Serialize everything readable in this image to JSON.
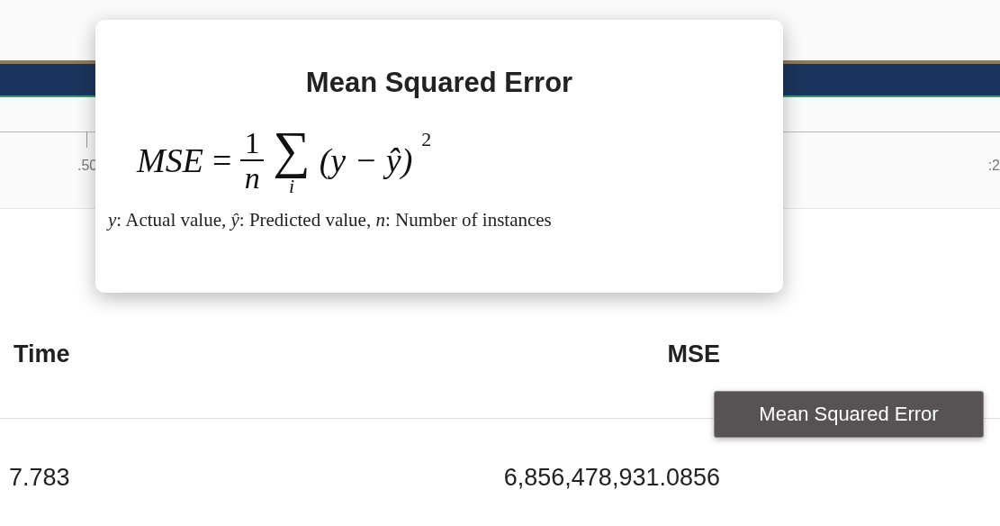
{
  "timeline": {
    "axis_labels": [
      ".50",
      ":2"
    ]
  },
  "popover": {
    "title": "Mean Squared Error",
    "formula": {
      "lhs": "MSE",
      "equals": "=",
      "numerator": "1",
      "denominator": "n",
      "sum": "∑",
      "sum_index": "i",
      "body": "(y − ŷ)",
      "exponent": "2"
    },
    "legend": "*y*: Actual value, *ŷ*: Predicted value, *n*: Number of instances"
  },
  "table": {
    "columns": [
      "Time",
      "MSE"
    ],
    "rows": [
      [
        "7.783",
        "6,856,478,931.0856"
      ]
    ]
  },
  "tooltip": {
    "text": "Mean Squared Error"
  }
}
